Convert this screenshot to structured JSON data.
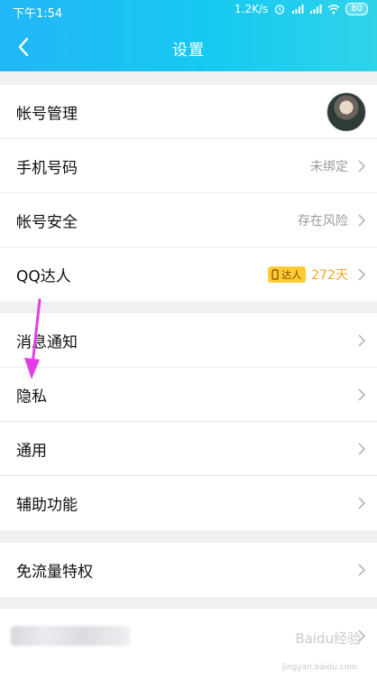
{
  "status": {
    "time": "下午1:54",
    "speed": "1.2K/s",
    "battery": "80"
  },
  "header": {
    "title": "设置"
  },
  "groups": [
    {
      "items": [
        {
          "label": "帐号管理",
          "value": ""
        },
        {
          "label": "手机号码",
          "value": "未绑定"
        },
        {
          "label": "帐号安全",
          "value": "存在风险"
        },
        {
          "label": "QQ达人",
          "badge": "达人",
          "days": "272天"
        }
      ]
    },
    {
      "items": [
        {
          "label": "消息通知"
        },
        {
          "label": "隐私"
        },
        {
          "label": "通用"
        },
        {
          "label": "辅助功能"
        }
      ]
    },
    {
      "items": [
        {
          "label": "免流量特权"
        }
      ]
    }
  ],
  "watermark": {
    "brand": "Baidu经验",
    "url": "jingyan.baidu.com"
  },
  "colors": {
    "header_start": "#23b6f7",
    "header_end": "#2fd3ea",
    "annotation_arrow": "#e23ee8",
    "daren_badge": "#ffcc33",
    "daren_days": "#f5a623"
  },
  "icons": [
    "back-arrow-icon",
    "chevron-right-icon",
    "wifi-icon",
    "signal-icon",
    "alarm-icon",
    "battery-icon"
  ]
}
